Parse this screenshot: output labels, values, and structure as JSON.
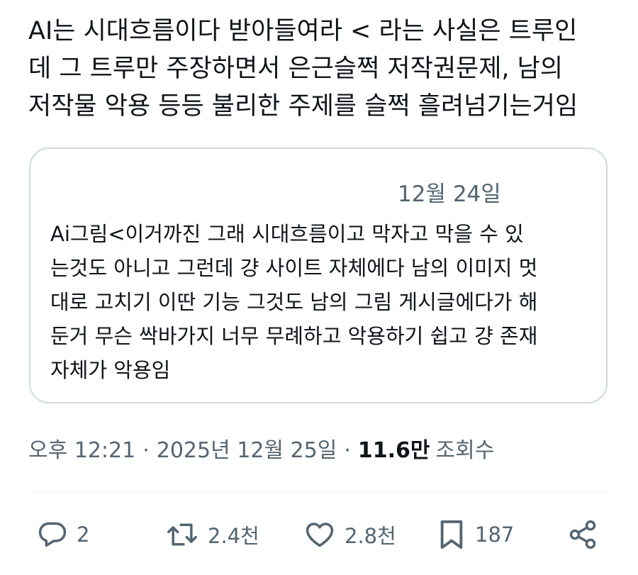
{
  "tweet": {
    "text": "AI는 시대흐름이다 받아들여라 < 라는 사실은 트루인\n데 그 트루만 주장하면서 은근슬쩍 저작권문제, 남의\n저작물 악용 등등 불리한 주제를 슬쩍 흘려넘기는거임"
  },
  "quote": {
    "date": "12월 24일",
    "text": "Ai그림<이거까진 그래 시대흐름이고 막자고 막을 수 있\n는것도 아니고 그런데 걍 사이트 자체에다 남의 이미지 멋\n대로 고치기 이딴 기능 그것도 남의 그림 게시글에다가 해\n둔거 무슨 싹바가지 너무 무례하고 악용하기 쉽고 걍 존재\n자체가 악용임"
  },
  "meta": {
    "time": "오후 12:21",
    "separator": "·",
    "date": "2025년 12월 25일",
    "views_count": "11.6만",
    "views_label": "조회수"
  },
  "actions": {
    "reply_count": "2",
    "repost_count": "2.4천",
    "like_count": "2.8천",
    "bookmark_count": "187",
    "icons": [
      "reply-icon",
      "repost-icon",
      "like-icon",
      "bookmark-icon",
      "share-icon"
    ]
  },
  "colors": {
    "text": "#0f1419",
    "secondary": "#536471",
    "border": "#cfd9de"
  }
}
